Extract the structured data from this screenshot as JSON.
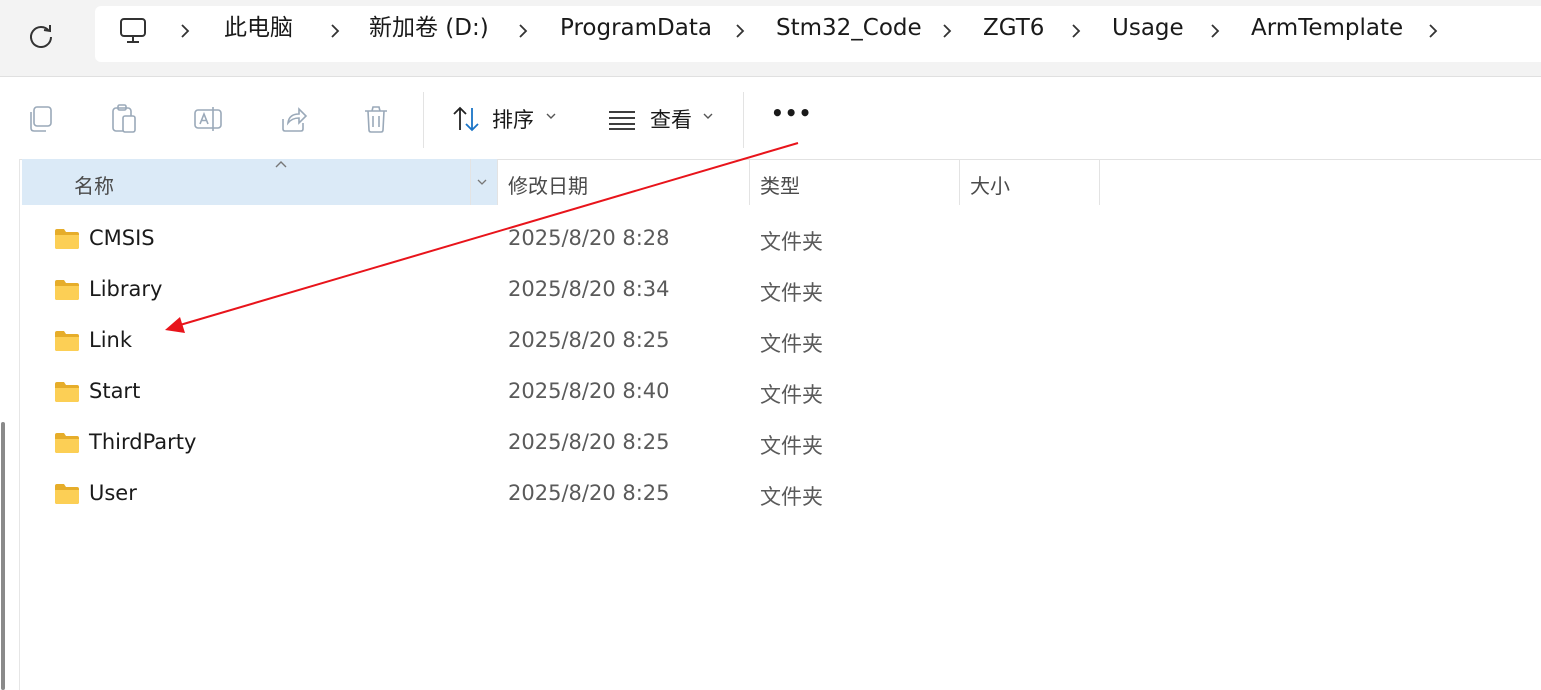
{
  "breadcrumb": {
    "items": [
      "此电脑",
      "新加卷 (D:)",
      "ProgramData",
      "Stm32_Code",
      "ZGT6",
      "Usage",
      "ArmTemplate"
    ]
  },
  "toolbar": {
    "sort_label": "排序",
    "view_label": "查看",
    "more_label": "•••"
  },
  "columns": {
    "name": "名称",
    "modified": "修改日期",
    "type": "类型",
    "size": "大小"
  },
  "files": [
    {
      "name": "CMSIS",
      "modified": "2025/8/20 8:28",
      "type": "文件夹"
    },
    {
      "name": "Library",
      "modified": "2025/8/20 8:34",
      "type": "文件夹"
    },
    {
      "name": "Link",
      "modified": "2025/8/20 8:25",
      "type": "文件夹"
    },
    {
      "name": "Start",
      "modified": "2025/8/20 8:40",
      "type": "文件夹"
    },
    {
      "name": "ThirdParty",
      "modified": "2025/8/20 8:25",
      "type": "文件夹"
    },
    {
      "name": "User",
      "modified": "2025/8/20 8:25",
      "type": "文件夹"
    }
  ],
  "colors": {
    "folder": "#f7c84b",
    "header_selected": "#dbeaf7",
    "annotation_arrow": "#e8141b"
  }
}
